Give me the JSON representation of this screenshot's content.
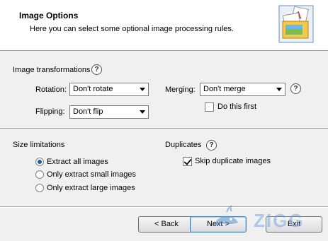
{
  "header": {
    "title": "Image Options",
    "subtitle": "Here you can select some optional image processing rules.",
    "graphic_icon": "images-folder-icon"
  },
  "transformations": {
    "label": "Image transformations",
    "rotation_label": "Rotation:",
    "rotation_value": "Don't rotate",
    "flipping_label": "Flipping:",
    "flipping_value": "Don't flip",
    "merging_label": "Merging:",
    "merging_value": "Don't merge",
    "do_this_first_label": "Do this first",
    "do_this_first_checked": false
  },
  "size_limitations": {
    "label": "Size limitations",
    "options": [
      {
        "label": "Extract all images",
        "selected": true
      },
      {
        "label": "Only extract small images",
        "selected": false
      },
      {
        "label": "Only extract large images",
        "selected": false
      }
    ]
  },
  "duplicates": {
    "label": "Duplicates",
    "skip_label": "Skip duplicate images",
    "skip_checked": true
  },
  "buttons": {
    "back": "< Back",
    "next": "Next >",
    "exit": "Exit"
  },
  "watermark": {
    "text": "ZIGG"
  },
  "help_glyph": "?",
  "colors": {
    "accent": "#1c5fb0",
    "header_bg": "#ffffff",
    "dialog_bg": "#f0f0f0"
  }
}
